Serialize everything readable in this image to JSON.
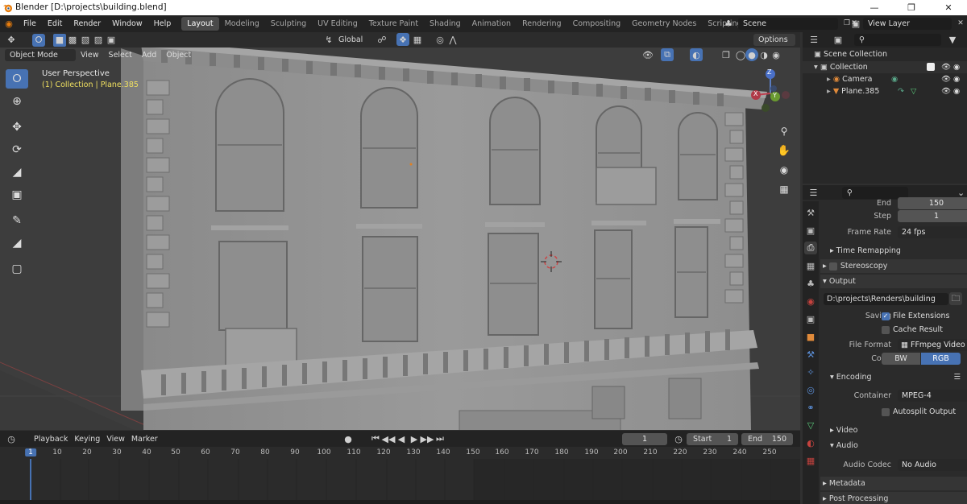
{
  "window": {
    "title": "Blender [D:\\projects\\building.blend]"
  },
  "menu": [
    "File",
    "Edit",
    "Render",
    "Window",
    "Help"
  ],
  "workspaces": [
    "Layout",
    "Modeling",
    "Sculpting",
    "UV Editing",
    "Texture Paint",
    "Shading",
    "Animation",
    "Rendering",
    "Compositing",
    "Geometry Nodes",
    "Scripting"
  ],
  "active_workspace": "Layout",
  "scene": {
    "name": "Scene",
    "view_layer": "View Layer"
  },
  "viewport": {
    "mode": "Object Mode",
    "menus": [
      "View",
      "Select",
      "Add",
      "Object"
    ],
    "transform_orientation": "Global",
    "options_label": "Options",
    "overlay_title": "User Perspective",
    "overlay_subtitle": "(1) Collection | Plane.385",
    "gizmo": {
      "x": "X",
      "y": "Y",
      "z": "Z"
    }
  },
  "outliner": {
    "root": "Scene Collection",
    "collection": "Collection",
    "items": [
      "Camera",
      "Plane.385"
    ]
  },
  "properties": {
    "end_label": "End",
    "end_value": "150",
    "step_label": "Step",
    "step_value": "1",
    "frame_rate_label": "Frame Rate",
    "frame_rate_value": "24 fps",
    "time_remapping": "Time Remapping",
    "stereoscopy": "Stereoscopy",
    "output": "Output",
    "output_path": "D:\\projects\\Renders\\building",
    "saving_label": "Saving",
    "file_extensions": "File Extensions",
    "cache_result": "Cache Result",
    "file_format_label": "File Format",
    "file_format_value": "FFmpeg Video",
    "color_label": "Color",
    "color_bw": "BW",
    "color_rgb": "RGB",
    "encoding": "Encoding",
    "container_label": "Container",
    "container_value": "MPEG-4",
    "autosplit": "Autosplit Output",
    "video": "Video",
    "audio": "Audio",
    "audio_codec_label": "Audio Codec",
    "audio_codec_value": "No Audio",
    "metadata": "Metadata",
    "post_processing": "Post Processing"
  },
  "timeline": {
    "menus": [
      "Playback",
      "Keying",
      "View",
      "Marker"
    ],
    "current_frame": "1",
    "start_label": "Start",
    "start_value": "1",
    "end_label": "End",
    "end_value": "150",
    "ruler": [
      "1",
      "10",
      "20",
      "30",
      "40",
      "50",
      "60",
      "70",
      "80",
      "90",
      "100",
      "110",
      "120",
      "130",
      "140",
      "150",
      "160",
      "170",
      "180",
      "190",
      "200",
      "210",
      "220",
      "230",
      "240",
      "250"
    ]
  },
  "colors": {
    "accent": "#4772b3",
    "header": "#232323",
    "panel": "#2b2b2b",
    "viewport": "#3a3a3a",
    "active_text": "#f0e060"
  }
}
